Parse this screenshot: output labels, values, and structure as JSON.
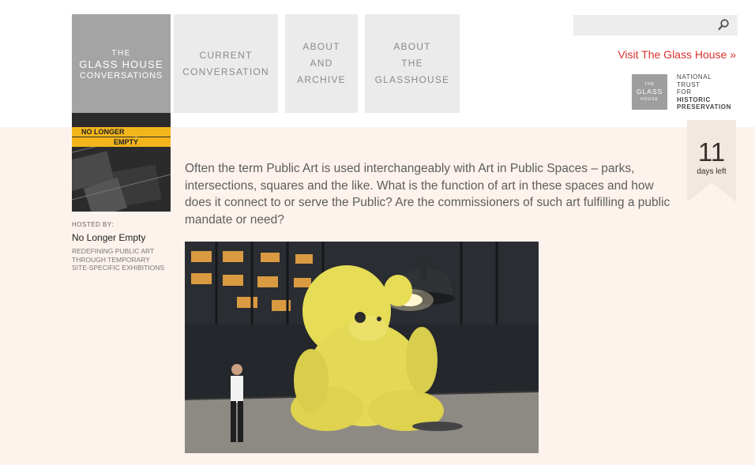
{
  "logo": {
    "line1": "THE",
    "line2": "GLASS HOUSE",
    "line3": "CONVERSATIONS"
  },
  "nav": [
    {
      "line1": "CURRENT",
      "line2": "CONVERSATION"
    },
    {
      "line1": "ABOUT",
      "line2": "AND",
      "line3": "ARCHIVE"
    },
    {
      "line1": "ABOUT",
      "line2": "THE",
      "line3": "GLASSHOUSE"
    }
  ],
  "search": {
    "placeholder": "",
    "icon": "search-icon"
  },
  "visit_link": "Visit The Glass House »",
  "glasshouse_badge": {
    "line1": "THE",
    "line2": "GLASS",
    "line3": "HOUSE"
  },
  "national_trust": [
    "NATIONAL",
    "TRUST",
    "FOR",
    "HISTORIC",
    "PRESERVATION"
  ],
  "days_left": {
    "number": "11",
    "label": "days left"
  },
  "host": {
    "image_text": {
      "line1": "NO LONGER",
      "line2": "EMPTY"
    },
    "hosted_by": "HOSTED BY:",
    "name": "No Longer Empty",
    "description": [
      "REDEFINING PUBLIC ART",
      "THROUGH TEMPORARY",
      "SITE-SPECIFIC EXHIBITIONS"
    ]
  },
  "intro_text": "Often the term Public Art is used interchangeably with Art in Public Spaces – parks, intersections, squares and the like. What is the function of art in these spaces and how does it connect to or serve the Public? Are the commissioners of such art fulfilling a public mandate or need?",
  "colors": {
    "accent_red": "#d9312e",
    "band": "#fdf2ec",
    "nav_grey": "#ebebeb",
    "logo_grey": "#a4a4a4",
    "tape_yellow": "#f2b51c"
  }
}
